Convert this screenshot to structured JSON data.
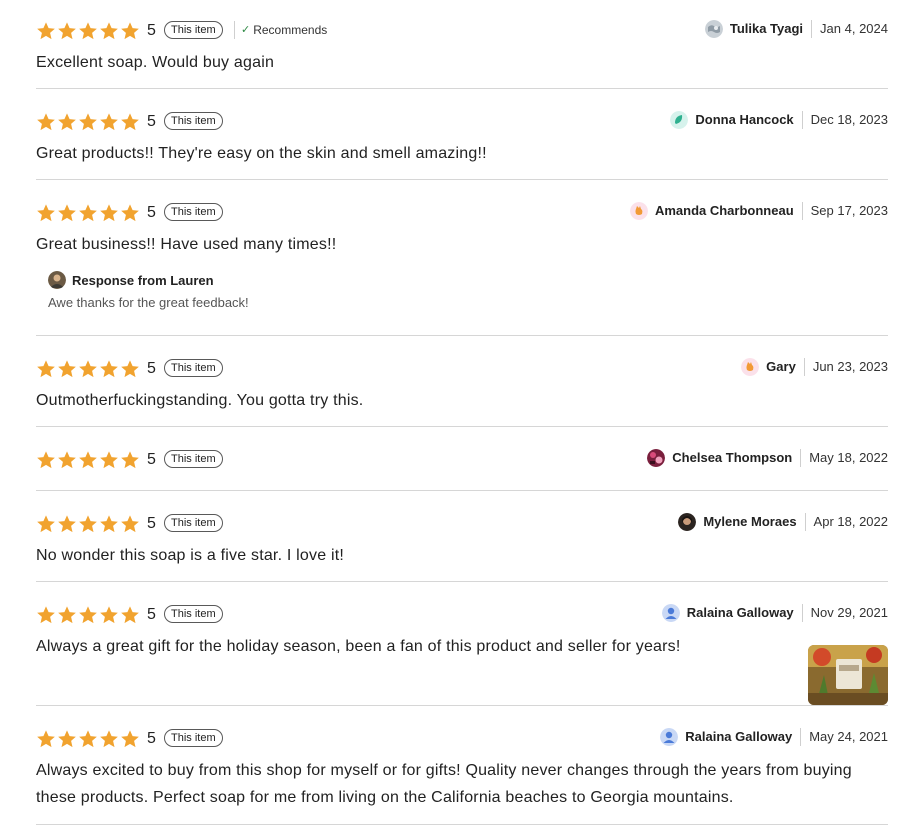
{
  "colors": {
    "star": "#F1A32F",
    "divider": "#D6D6D6",
    "recommend_check": "#2F8A45"
  },
  "reviews": [
    {
      "rating": "5",
      "this_item_label": "This item",
      "recommends_label": "Recommends",
      "reviewer": "Tulika Tyagi",
      "date": "Jan 4, 2024",
      "text": "Excellent soap. Would buy again",
      "avatar_icon": "gray-map-avatar-icon"
    },
    {
      "rating": "5",
      "this_item_label": "This item",
      "reviewer": "Donna Hancock",
      "date": "Dec 18, 2023",
      "text": "Great products!! They're easy on the skin and smell amazing!!",
      "avatar_icon": "teal-leaf-avatar-icon"
    },
    {
      "rating": "5",
      "this_item_label": "This item",
      "reviewer": "Amanda Charbonneau",
      "date": "Sep 17, 2023",
      "text": "Great business!! Have used many times!!",
      "avatar_icon": "orange-hand-avatar-icon",
      "response": {
        "title": "Response from Lauren",
        "text": "Awe thanks for the great feedback!"
      }
    },
    {
      "rating": "5",
      "this_item_label": "This item",
      "reviewer": "Gary",
      "date": "Jun 23, 2023",
      "text": "Outmotherfuckingstanding. You gotta try this.",
      "avatar_icon": "orange-hand-avatar-icon"
    },
    {
      "rating": "5",
      "this_item_label": "This item",
      "reviewer": "Chelsea Thompson",
      "date": "May 18, 2022",
      "text": "",
      "avatar_icon": "photo-avatar-icon"
    },
    {
      "rating": "5",
      "this_item_label": "This item",
      "reviewer": "Mylene Moraes",
      "date": "Apr 18, 2022",
      "text": "No wonder this soap is a five star. I love it!",
      "avatar_icon": "photo-avatar-icon"
    },
    {
      "rating": "5",
      "this_item_label": "This item",
      "reviewer": "Ralaina Galloway",
      "date": "Nov 29, 2021",
      "text": "Always a great gift for the holiday season, been a fan of this product and seller for years!",
      "avatar_icon": "blue-person-avatar-icon",
      "photo_icon": "review-photo-icon"
    },
    {
      "rating": "5",
      "this_item_label": "This item",
      "reviewer": "Ralaina Galloway",
      "date": "May 24, 2021",
      "text": "Always excited to buy from this shop for myself or for gifts! Quality never changes through the years from buying these products. Perfect soap for me from living on the California beaches to Georgia mountains.",
      "avatar_icon": "blue-person-avatar-icon"
    }
  ]
}
